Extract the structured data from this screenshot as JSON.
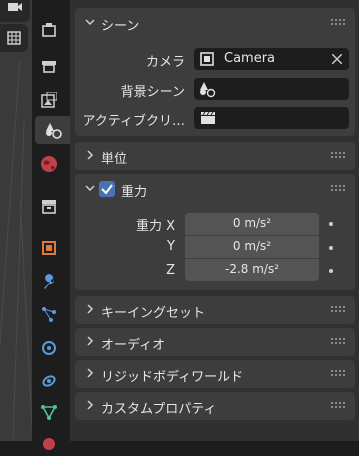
{
  "sidebar": {
    "icons": [
      "tool-icon",
      "render-icon",
      "output-icon",
      "view-layer-icon",
      "scene-icon",
      "world-icon",
      "collection-icon",
      "object-icon",
      "modifier-icon",
      "particles-icon",
      "physics-icon",
      "constraints-icon",
      "data-icon",
      "material-icon"
    ]
  },
  "scene_panel": {
    "title": "シーン",
    "camera_label": "カメラ",
    "camera_value": "Camera",
    "background_label": "背景シーン",
    "active_clip_label": "アクティブクリ…"
  },
  "units_panel": {
    "title": "単位"
  },
  "gravity_panel": {
    "title": "重力",
    "enabled": true,
    "x_label": "重力 X",
    "x_value": "0 m/s²",
    "y_label": "Y",
    "y_value": "0 m/s²",
    "z_label": "Z",
    "z_value": "-2.8 m/s²"
  },
  "collapsed_panels": {
    "keying_sets": "キーイングセット",
    "audio": "オーディオ",
    "rigid_body_world": "リジッドボディワールド",
    "custom_properties": "カスタムプロパティ"
  },
  "colors": {
    "editor_bg": "#303030",
    "panel_bg": "#3d3d3d",
    "field_bg": "#545454",
    "checkbox": "#4772b3",
    "active_tab": "#3d3d3d"
  }
}
